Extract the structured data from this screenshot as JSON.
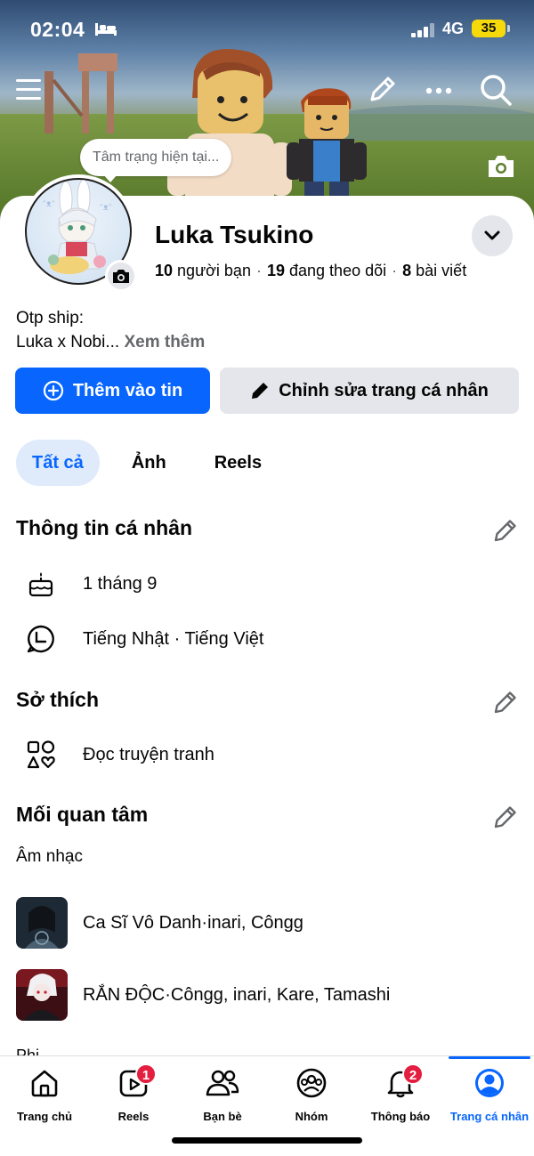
{
  "status_bar": {
    "time": "02:04",
    "network": "4G",
    "battery": "35"
  },
  "cover": {
    "mood_placeholder": "Tâm trạng hiện tại..."
  },
  "profile": {
    "name": "Luka Tsukino",
    "friends_count": "10",
    "friends_label": "người bạn",
    "following_count": "19",
    "following_label": "đang theo dõi",
    "posts_count": "8",
    "posts_label": "bài viết",
    "bio_line1": "Otp ship:",
    "bio_line2": "Luka x Nobi...",
    "see_more": "Xem thêm"
  },
  "actions": {
    "add_story": "Thêm vào tin",
    "edit_profile": "Chỉnh sửa trang cá nhân"
  },
  "tabs": [
    {
      "label": "Tất cả"
    },
    {
      "label": "Ảnh"
    },
    {
      "label": "Reels"
    }
  ],
  "personal_info": {
    "title": "Thông tin cá nhân",
    "birthday": "1 tháng 9",
    "languages": "Tiếng Nhật · Tiếng Việt"
  },
  "hobbies": {
    "title": "Sở thích",
    "item": "Đọc truyện tranh"
  },
  "interests": {
    "title": "Mối quan tâm",
    "subtitle": "Âm nhạc",
    "items": [
      {
        "label": "Ca Sĩ Vô Danh·inari, Côngg"
      },
      {
        "label": "RẮN ĐỘC·Côngg, inari, Kare, Tamashi"
      }
    ],
    "cut_off": "Phi"
  },
  "nav": {
    "items": [
      {
        "label": "Trang chủ",
        "icon": "home-icon"
      },
      {
        "label": "Reels",
        "icon": "reels-icon",
        "badge": "1"
      },
      {
        "label": "Bạn bè",
        "icon": "friends-icon"
      },
      {
        "label": "Nhóm",
        "icon": "groups-icon"
      },
      {
        "label": "Thông báo",
        "icon": "bell-icon",
        "badge": "2"
      },
      {
        "label": "Trang cá nhân",
        "icon": "profile-icon"
      }
    ]
  },
  "colors": {
    "accent": "#0866ff",
    "badge": "#e41e3f",
    "button_gray": "#e4e6eb",
    "tab_active_bg": "#dfeafb"
  }
}
